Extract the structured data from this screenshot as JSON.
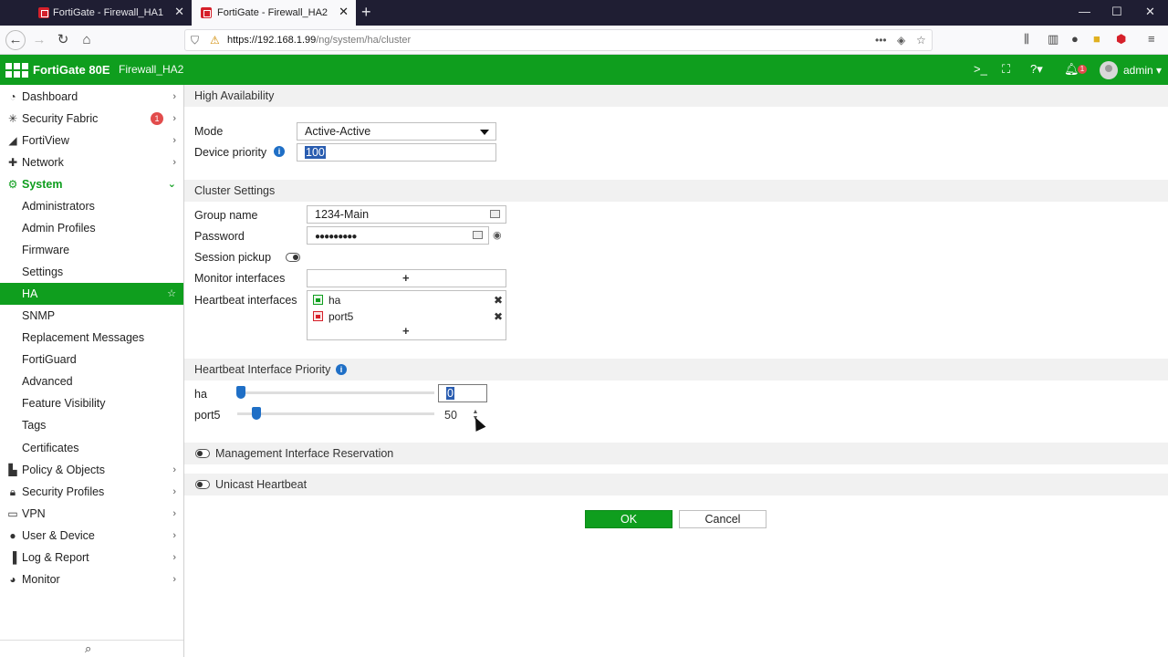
{
  "browser": {
    "tabs": [
      {
        "title": "FortiGate - Firewall_HA1",
        "active": false
      },
      {
        "title": "FortiGate - Firewall_HA2",
        "active": true
      }
    ],
    "url_host": "https://192.168.1.99",
    "url_path": "/ng/system/ha/cluster"
  },
  "header": {
    "model": "FortiGate 80E",
    "hostname": "Firewall_HA2",
    "notification_count": "1",
    "user": "admin"
  },
  "sidebar": {
    "items": [
      {
        "label": "Dashboard",
        "icon": "dashboard-icon"
      },
      {
        "label": "Security Fabric",
        "icon": "security-fabric-icon",
        "badge": "1"
      },
      {
        "label": "FortiView",
        "icon": "fortiview-icon"
      },
      {
        "label": "Network",
        "icon": "network-icon"
      },
      {
        "label": "System",
        "icon": "gear-icon",
        "expanded": true
      },
      {
        "label": "Administrators"
      },
      {
        "label": "Admin Profiles"
      },
      {
        "label": "Firmware"
      },
      {
        "label": "Settings"
      },
      {
        "label": "HA",
        "selected": true
      },
      {
        "label": "SNMP"
      },
      {
        "label": "Replacement Messages"
      },
      {
        "label": "FortiGuard"
      },
      {
        "label": "Advanced"
      },
      {
        "label": "Feature Visibility"
      },
      {
        "label": "Tags"
      },
      {
        "label": "Certificates"
      },
      {
        "label": "Policy & Objects",
        "icon": "policy-icon"
      },
      {
        "label": "Security Profiles",
        "icon": "lock-icon"
      },
      {
        "label": "VPN",
        "icon": "vpn-icon"
      },
      {
        "label": "User & Device",
        "icon": "user-icon"
      },
      {
        "label": "Log & Report",
        "icon": "log-icon"
      },
      {
        "label": "Monitor",
        "icon": "monitor-icon"
      }
    ]
  },
  "ha": {
    "section_title": "High Availability",
    "mode_label": "Mode",
    "mode_value": "Active-Active",
    "priority_label": "Device priority",
    "priority_value": "100"
  },
  "cluster": {
    "section_title": "Cluster Settings",
    "group_name_label": "Group name",
    "group_name_value": "1234-Main",
    "password_label": "Password",
    "password_value": "●●●●●●●●●",
    "session_pickup_label": "Session pickup",
    "monitor_label": "Monitor interfaces",
    "heartbeat_label": "Heartbeat interfaces",
    "heartbeat_interfaces": [
      {
        "name": "ha",
        "status": "up"
      },
      {
        "name": "port5",
        "status": "down"
      }
    ]
  },
  "heartbeat_priority": {
    "section_title": "Heartbeat Interface Priority",
    "rows": [
      {
        "name": "ha",
        "value": "0",
        "level": 0.0
      },
      {
        "name": "port5",
        "value": "50",
        "level": 0.1
      }
    ]
  },
  "mgmt_reservation_label": "Management Interface Reservation",
  "unicast_heartbeat_label": "Unicast Heartbeat",
  "buttons": {
    "ok": "OK",
    "cancel": "Cancel"
  }
}
